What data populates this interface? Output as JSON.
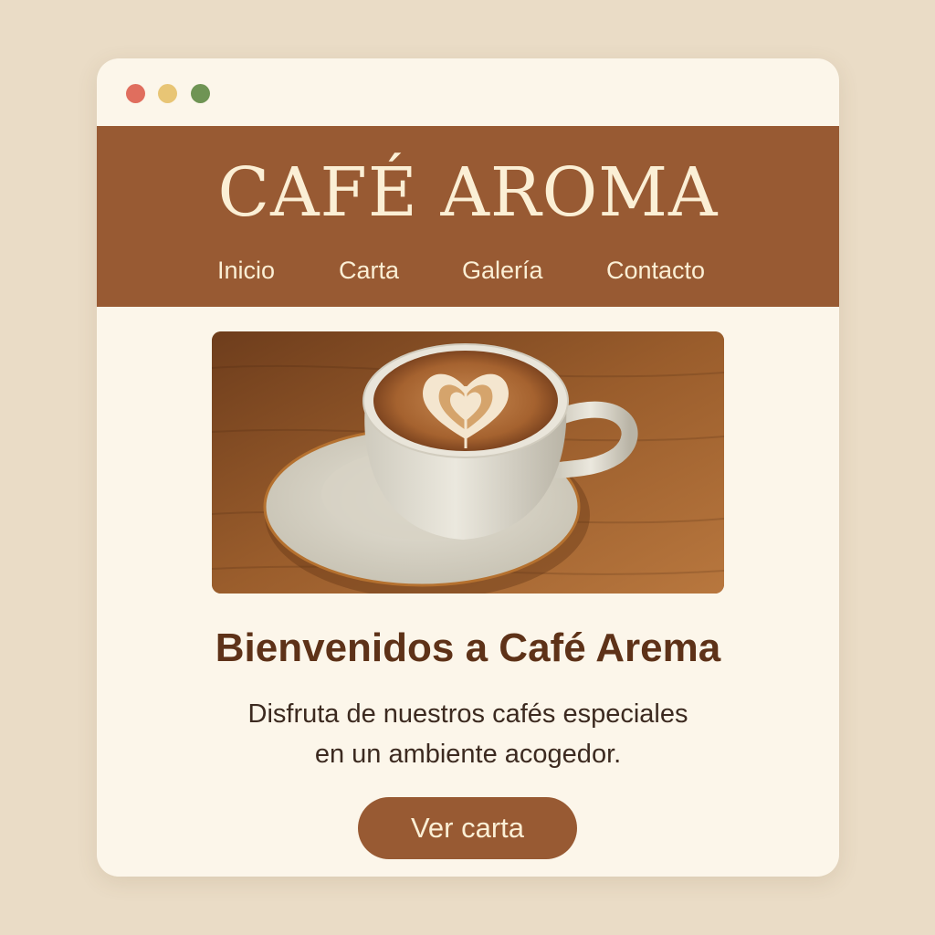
{
  "window": {
    "controls": [
      "close",
      "minimize",
      "maximize"
    ]
  },
  "header": {
    "brand": "CAFÉ AROMA",
    "nav": [
      {
        "label": "Inicio"
      },
      {
        "label": "Carta"
      },
      {
        "label": "Galería"
      },
      {
        "label": "Contacto"
      }
    ]
  },
  "hero": {
    "image": "latte-art-cup-on-saucer"
  },
  "main": {
    "welcome": "Bienvenidos a Café Arema",
    "description_line1": "Disfruta de nuestros cafés especiales",
    "description_line2": "en un ambiente acogedor.",
    "cta_label": "Ver carta"
  },
  "colors": {
    "background": "#eadcc6",
    "window": "#fcf6ea",
    "header": "#985a33",
    "header_text": "#fbefd5",
    "heading": "#5e3218",
    "button": "#985a33"
  }
}
